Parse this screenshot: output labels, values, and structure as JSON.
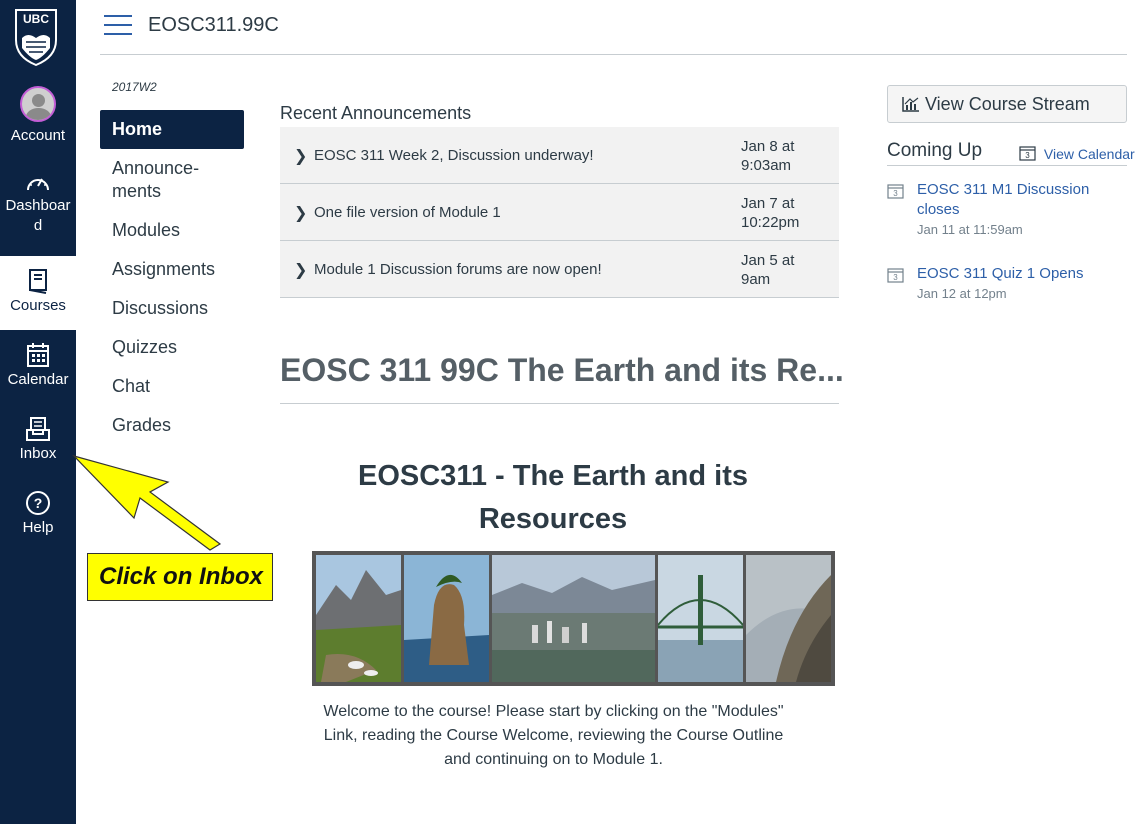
{
  "global_nav": {
    "logo_text": "UBC",
    "items": [
      {
        "label": "Account",
        "icon": "avatar-icon"
      },
      {
        "label": "Dashboard",
        "label_line1": "Dashboar",
        "label_line2": "d",
        "icon": "speedometer-icon"
      },
      {
        "label": "Courses",
        "icon": "book-icon"
      },
      {
        "label": "Calendar",
        "icon": "calendar-icon"
      },
      {
        "label": "Inbox",
        "icon": "inbox-icon"
      },
      {
        "label": "Help",
        "icon": "help-icon"
      }
    ],
    "colors": {
      "background": "#0c2343",
      "avatar_border": "#c35ed6"
    }
  },
  "header": {
    "course_code": "EOSC311.99C"
  },
  "course_nav": {
    "term": "2017W2",
    "items": [
      {
        "label": "Home"
      },
      {
        "label_line1": "Announce-",
        "label_line2": "ments"
      },
      {
        "label": "Modules"
      },
      {
        "label": "Assignments"
      },
      {
        "label": "Discussions"
      },
      {
        "label": "Quizzes"
      },
      {
        "label": "Chat"
      },
      {
        "label": "Grades"
      }
    ]
  },
  "announcements": {
    "title": "Recent Announcements",
    "items": [
      {
        "title": "EOSC 311 Week 2, Discussion underway!",
        "date_line1": "Jan 8 at",
        "date_line2": "9:03am"
      },
      {
        "title": "One file version of Module 1",
        "date_line1": "Jan 7 at",
        "date_line2": "10:22pm"
      },
      {
        "title": "Module 1 Discussion forums are now open!",
        "date_line1": "Jan 5 at",
        "date_line2": "9am"
      }
    ]
  },
  "main": {
    "page_heading": "EOSC 311 99C The Earth and its Re...",
    "welcome_title": "EOSC311 - The Earth and its Resources",
    "welcome_text": "Welcome to the course!  Please start by clicking on the \"Modules\" Link, reading the Course Welcome, reviewing the Course Outline and continuing on to Module 1."
  },
  "sidebar": {
    "stream_button": "View Course Stream",
    "coming_up": "Coming Up",
    "view_calendar": "View Calendar",
    "calendar_day": "3",
    "todos": [
      {
        "title": "EOSC 311 M1 Discussion closes",
        "date": "Jan 11 at 11:59am"
      },
      {
        "title": "EOSC 311 Quiz 1 Opens",
        "date": "Jan 12 at 12pm"
      }
    ]
  },
  "annotation": {
    "callout_text": "Click on Inbox",
    "colors": {
      "fill": "#ffff00"
    }
  }
}
